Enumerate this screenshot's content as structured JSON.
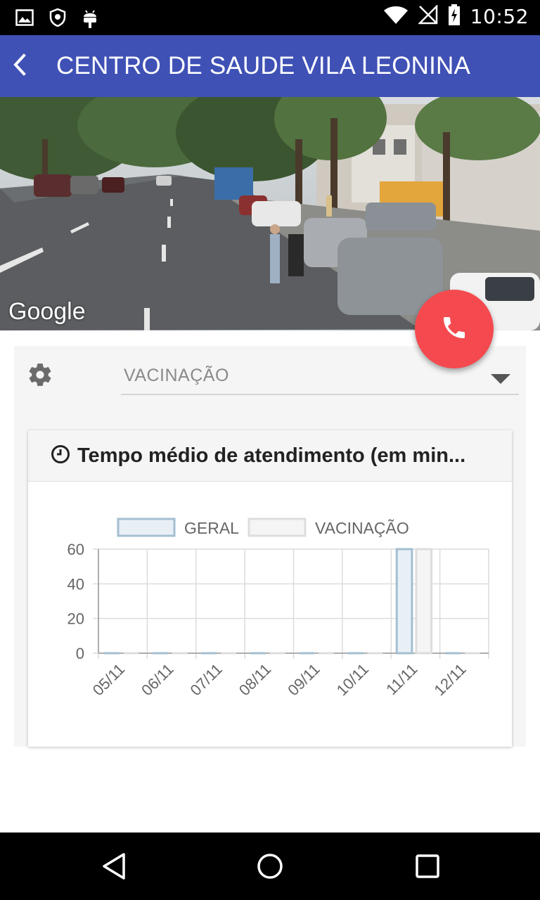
{
  "status_bar": {
    "time": "10:52",
    "left_icons": [
      "image-icon",
      "shield-icon",
      "android-icon"
    ],
    "right_icons": [
      "wifi-icon",
      "signal-off-icon",
      "battery-charging-icon"
    ]
  },
  "app_bar": {
    "title": "CENTRO DE SAUDE VILA LEONINA",
    "back_icon": "back-arrow-icon",
    "color": "#3f51b5"
  },
  "street_view": {
    "logo_text": "Google"
  },
  "fab": {
    "icon": "phone-icon",
    "color": "#f44a4f"
  },
  "filter": {
    "settings_icon": "gear-icon",
    "selected": "VACINAÇÃO"
  },
  "card": {
    "icon": "clock-icon",
    "title": "Tempo médio de atendimento (em min..."
  },
  "chart_data": {
    "type": "bar",
    "categories": [
      "05/11",
      "06/11",
      "07/11",
      "08/11",
      "09/11",
      "10/11",
      "11/11",
      "12/11"
    ],
    "series": [
      {
        "name": "GERAL",
        "values": [
          0,
          0,
          0,
          0,
          0,
          0,
          60,
          0
        ],
        "fill": "#e8f0f6",
        "stroke": "#a3bfd1"
      },
      {
        "name": "VACINAÇÃO",
        "values": [
          0,
          0,
          0,
          0,
          0,
          0,
          60,
          0
        ],
        "fill": "#f5f5f5",
        "stroke": "#dddddd"
      }
    ],
    "yticks": [
      0,
      20,
      40,
      60
    ],
    "ylim": [
      0,
      60
    ],
    "legend": "top-center",
    "grid": true
  },
  "nav_bar": {
    "icons": [
      "back-triangle-icon",
      "home-circle-icon",
      "recents-square-icon"
    ]
  }
}
